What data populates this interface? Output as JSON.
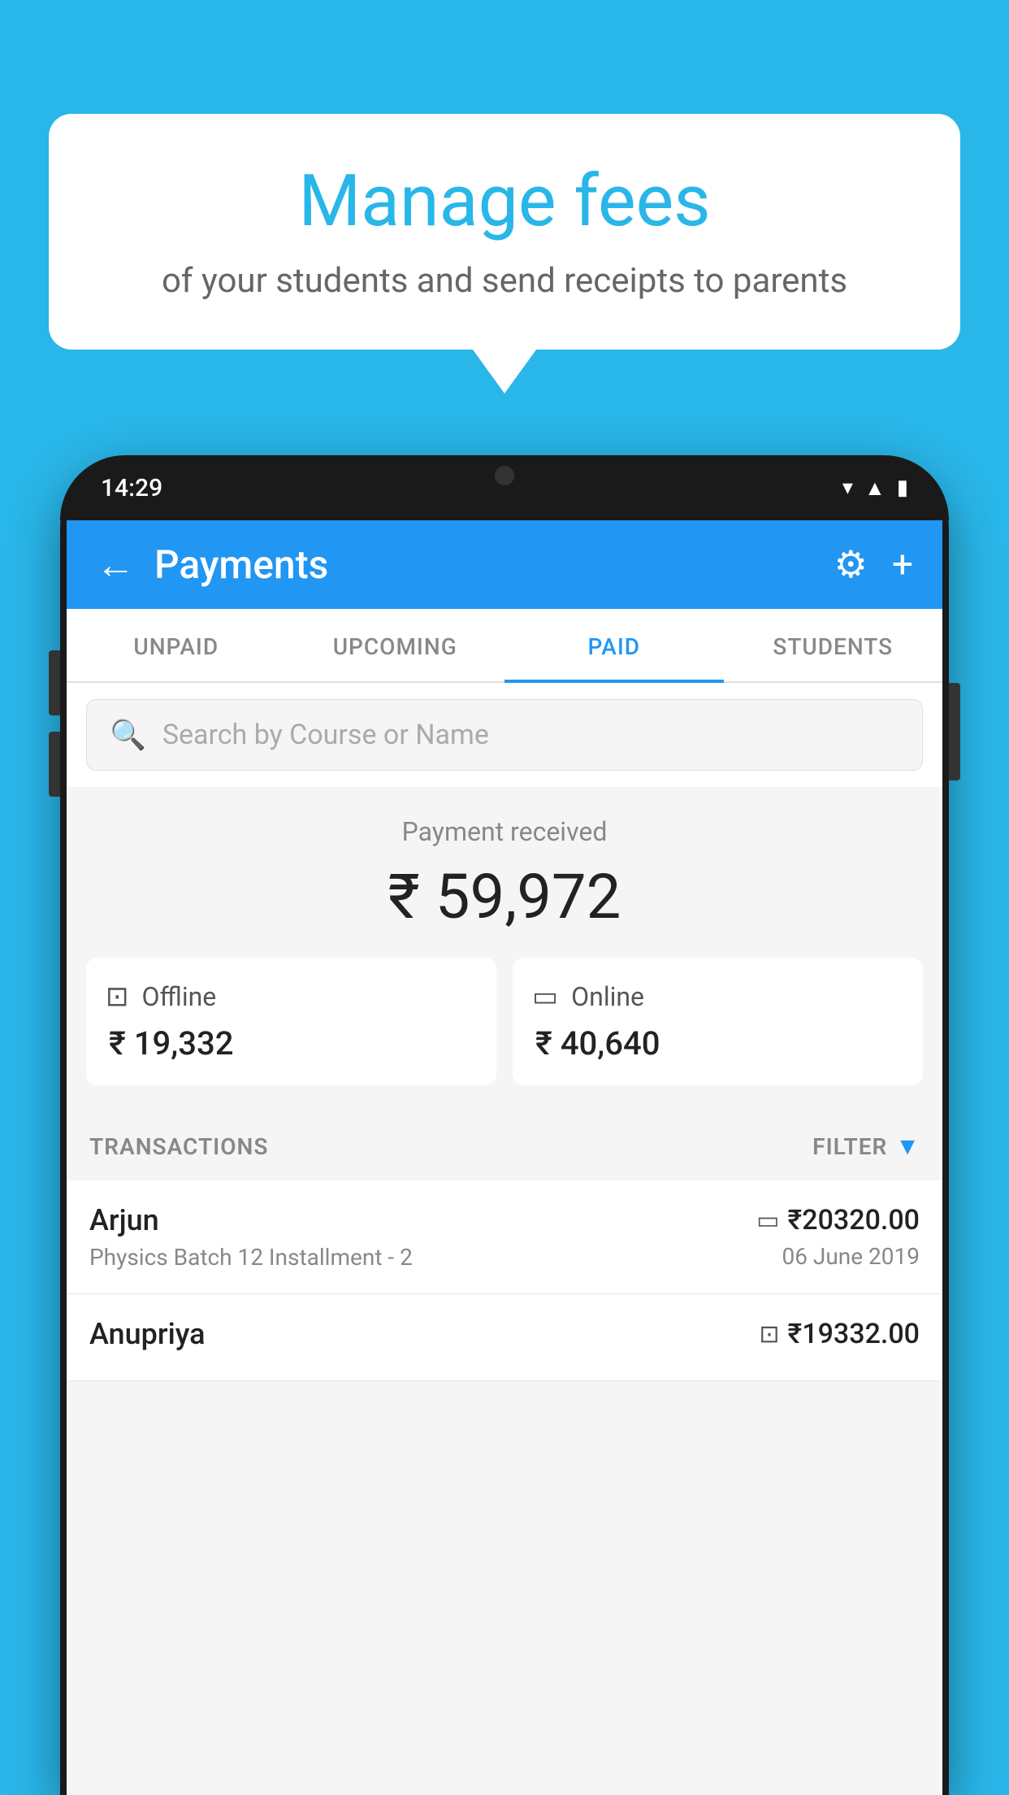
{
  "background_color": "#29B6E8",
  "speech_bubble": {
    "title": "Manage fees",
    "subtitle": "of your students and send receipts to parents"
  },
  "phone": {
    "status_bar": {
      "time": "14:29"
    },
    "app_header": {
      "title": "Payments",
      "back_label": "←",
      "settings_label": "⚙",
      "add_label": "+"
    },
    "tabs": [
      {
        "id": "unpaid",
        "label": "UNPAID",
        "active": false
      },
      {
        "id": "upcoming",
        "label": "UPCOMING",
        "active": false
      },
      {
        "id": "paid",
        "label": "PAID",
        "active": true
      },
      {
        "id": "students",
        "label": "STUDENTS",
        "active": false
      }
    ],
    "search": {
      "placeholder": "Search by Course or Name"
    },
    "payment_summary": {
      "label": "Payment received",
      "total": "₹ 59,972",
      "offline": {
        "label": "Offline",
        "amount": "₹ 19,332"
      },
      "online": {
        "label": "Online",
        "amount": "₹ 40,640"
      }
    },
    "transactions_section": {
      "label": "TRANSACTIONS",
      "filter_label": "FILTER"
    },
    "transactions": [
      {
        "name": "Arjun",
        "detail": "Physics Batch 12 Installment - 2",
        "amount": "₹20320.00",
        "date": "06 June 2019",
        "payment_type": "online"
      },
      {
        "name": "Anupriya",
        "detail": "",
        "amount": "₹19332.00",
        "date": "",
        "payment_type": "offline"
      }
    ]
  }
}
